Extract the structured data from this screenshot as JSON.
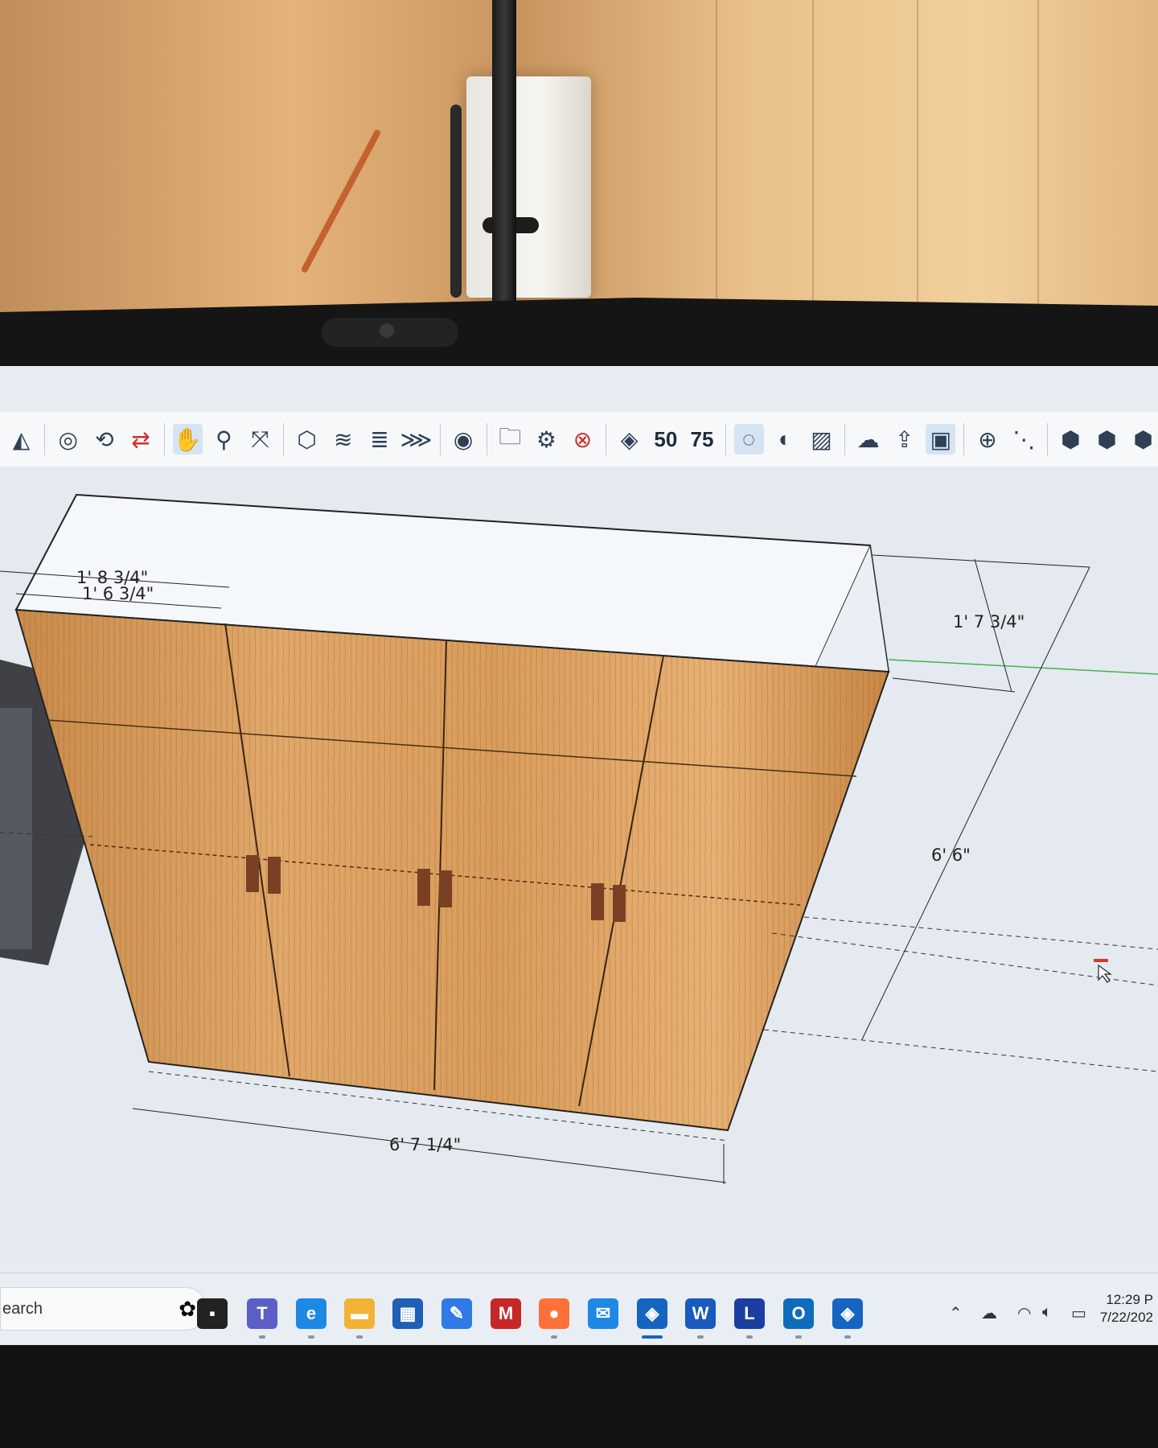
{
  "toolbar": {
    "tools": [
      {
        "icon": "section-plane-icon"
      },
      {
        "icon": "position-camera-icon"
      },
      {
        "icon": "look-around-icon"
      },
      {
        "icon": "orbit-icon"
      },
      {
        "icon": "pan-icon",
        "active": true
      },
      {
        "icon": "zoom-icon"
      },
      {
        "icon": "zoom-extents-icon"
      },
      {
        "icon": "model-info-icon"
      },
      {
        "icon": "layers-icon"
      },
      {
        "icon": "outliner-icon"
      },
      {
        "icon": "tags-icon"
      },
      {
        "icon": "account-icon"
      },
      {
        "icon": "open-folder-icon"
      },
      {
        "icon": "settings-gear-icon"
      },
      {
        "icon": "close-circle-icon"
      },
      {
        "icon": "preview-icon"
      },
      {
        "icon": "upload-50-icon"
      },
      {
        "icon": "upload-75-icon"
      },
      {
        "icon": "droplet-icon",
        "active": true
      },
      {
        "icon": "contrast-icon"
      },
      {
        "icon": "hatch-icon"
      },
      {
        "icon": "cloud-x-icon"
      },
      {
        "icon": "cloud-upload-icon"
      },
      {
        "icon": "sketchup-cursor-icon",
        "active": true
      },
      {
        "icon": "add-point-icon"
      },
      {
        "icon": "dashed-line-icon"
      },
      {
        "icon": "hexagon-clock-icon"
      },
      {
        "icon": "hexagon-slash-icon"
      },
      {
        "icon": "hexagon-cloud-icon"
      }
    ],
    "num50": "50",
    "num75": "75"
  },
  "dimensions": {
    "top_outer": "1' 8 3/4\"",
    "top_inner": "1' 6 3/4\"",
    "depth": "1' 7 3/4\"",
    "height": "6' 6\"",
    "width": "6' 7 1/4\""
  },
  "taskbar": {
    "search_text": "earch",
    "apps": [
      {
        "icon": "task-view-icon",
        "color": "#222222"
      },
      {
        "icon": "teams-icon",
        "color": "#5b5fc7"
      },
      {
        "icon": "edge-icon",
        "color": "#1e88e5"
      },
      {
        "icon": "file-explorer-icon",
        "color": "#f2b233"
      },
      {
        "icon": "store-icon",
        "color": "#1f5fb5"
      },
      {
        "icon": "sketch-app-icon",
        "color": "#2f7ae5"
      },
      {
        "icon": "mcafee-icon",
        "color": "#c62828"
      },
      {
        "icon": "firefox-icon",
        "color": "#ff7139"
      },
      {
        "icon": "mail-icon",
        "color": "#1e88e5"
      },
      {
        "icon": "sketchup-icon",
        "color": "#1565c0"
      },
      {
        "icon": "word-icon",
        "color": "#185abd"
      },
      {
        "icon": "l-app-icon",
        "color": "#1a3fa0"
      },
      {
        "icon": "outlook-icon",
        "color": "#0f6cbd"
      },
      {
        "icon": "sketchup-layout-icon",
        "color": "#1565c0"
      }
    ],
    "w_label": "W",
    "l_label": "L",
    "o_label": "O",
    "time": "12:29 P",
    "date": "7/22/202"
  }
}
